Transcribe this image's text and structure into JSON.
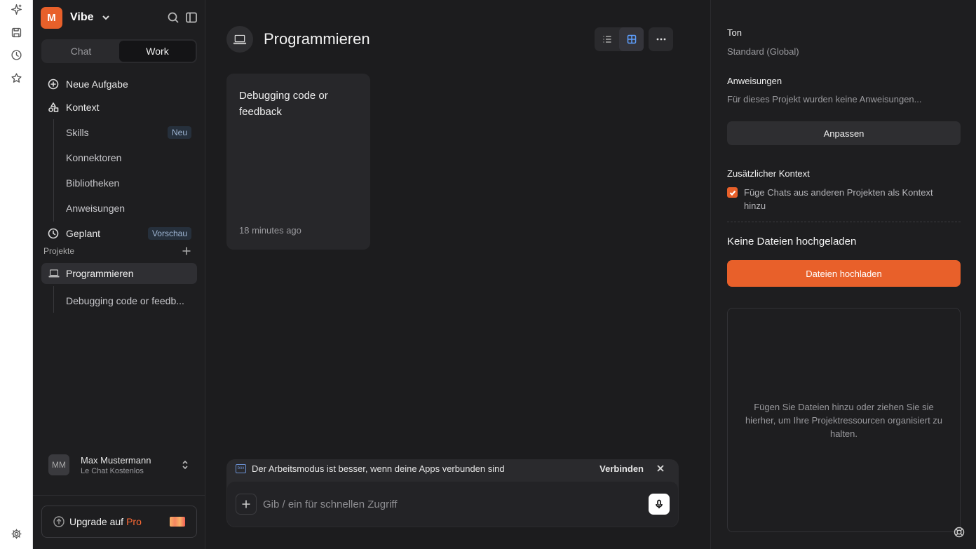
{
  "app": {
    "name": "Vibe",
    "logo_letter": "M",
    "accent_color": "#e8602a"
  },
  "rail": {
    "icons": [
      "sparkle-icon",
      "save-icon",
      "history-icon",
      "star-icon",
      "settings-icon"
    ]
  },
  "sidebar": {
    "mode_tabs": [
      {
        "label": "Chat",
        "active": false
      },
      {
        "label": "Work",
        "active": true
      }
    ],
    "items": {
      "new_task": "Neue Aufgabe",
      "context": "Kontext",
      "skills": "Skills",
      "skills_badge": "Neu",
      "connectors": "Konnektoren",
      "libraries": "Bibliotheken",
      "instructions": "Anweisungen",
      "scheduled": "Geplant",
      "scheduled_badge": "Vorschau"
    },
    "projects_label": "Projekte",
    "project": "Programmieren",
    "project_chat": "Debugging code or feedb...",
    "user": {
      "initials": "MM",
      "name": "Max Mustermann",
      "plan": "Le Chat Kostenlos"
    },
    "upgrade": {
      "label": "Upgrade auf",
      "highlight": "Pro"
    }
  },
  "main": {
    "title": "Programmieren",
    "card": {
      "title": "Debugging code or feedback",
      "time": "18 minutes ago"
    },
    "banner": {
      "text": "Der Arbeitsmodus ist besser, wenn deine Apps verbunden sind",
      "connect": "Verbinden",
      "box_label": "box"
    },
    "composer": {
      "placeholder": "Gib / ein für schnellen Zugriff",
      "value": ""
    }
  },
  "right_panel": {
    "tone_label": "Ton",
    "tone_value": "Standard (Global)",
    "instructions_label": "Anweisungen",
    "instructions_value": "Für dieses Projekt wurden keine Anweisungen...",
    "customize_button": "Anpassen",
    "extra_context_label": "Zusätzlicher Kontext",
    "extra_context_checkbox": "Füge Chats aus anderen Projekten als Kontext hinzu",
    "extra_context_checked": true,
    "files_heading": "Keine Dateien hochgeladen",
    "upload_button": "Dateien hochladen",
    "dropzone_text": "Fügen Sie Dateien hinzu oder ziehen Sie sie hierher, um Ihre Projektressourcen organisiert zu halten."
  }
}
